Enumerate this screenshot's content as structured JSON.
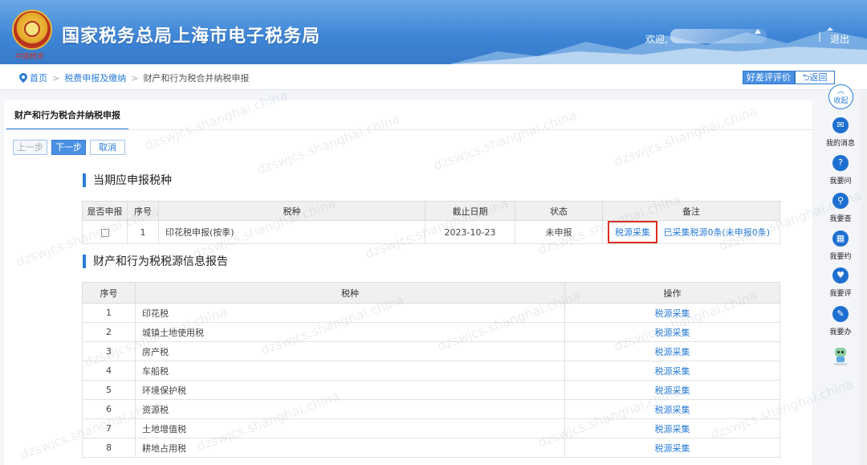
{
  "header": {
    "site_title": "国家税务总局上海市电子税务局",
    "sub_logo": "中国税务",
    "welcome": "欢迎,",
    "separator": "|",
    "logout": "退出"
  },
  "breadcrumb": {
    "home": "首页",
    "level1": "税费申报及缴纳",
    "level2": "财产和行为税合并纳税申报",
    "separator": ">"
  },
  "top_actions": {
    "eval": "好差评评价",
    "back": "返回"
  },
  "tab": {
    "label": "财产和行为税合并纳税申报"
  },
  "steps": {
    "prev": "上一步",
    "next": "下一步",
    "cancel": "取消"
  },
  "section1": {
    "title": "当期应申报税种",
    "headers": [
      "是否申报",
      "序号",
      "税种",
      "截止日期",
      "状态",
      "备注"
    ],
    "rows": [
      {
        "no": "1",
        "tax": "印花税申报(按季)",
        "deadline": "2023-10-23",
        "status": "未申报",
        "action": "税源采集",
        "note": "已采集税源0条(未申报0条)"
      }
    ]
  },
  "section2": {
    "title": "财产和行为税税源信息报告",
    "headers": [
      "序号",
      "税种",
      "操作"
    ],
    "rows": [
      {
        "no": "1",
        "tax": "印花税",
        "op": "税源采集"
      },
      {
        "no": "2",
        "tax": "城镇土地使用税",
        "op": "税源采集"
      },
      {
        "no": "3",
        "tax": "房产税",
        "op": "税源采集"
      },
      {
        "no": "4",
        "tax": "车船税",
        "op": "税源采集"
      },
      {
        "no": "5",
        "tax": "环境保护税",
        "op": "税源采集"
      },
      {
        "no": "6",
        "tax": "资源税",
        "op": "税源采集"
      },
      {
        "no": "7",
        "tax": "土地增值税",
        "op": "税源采集"
      },
      {
        "no": "8",
        "tax": "耕地占用税",
        "op": "税源采集"
      }
    ]
  },
  "right_rail": {
    "collapse": "收起",
    "items": [
      "我的消息",
      "我要问",
      "我要查",
      "我要约",
      "我要评",
      "我要办"
    ]
  },
  "watermark": "dzswjcs.shanghai.china",
  "colors": {
    "accent": "#2a7cd6",
    "highlight": "#e02b20",
    "banner": "#3f86d7"
  }
}
